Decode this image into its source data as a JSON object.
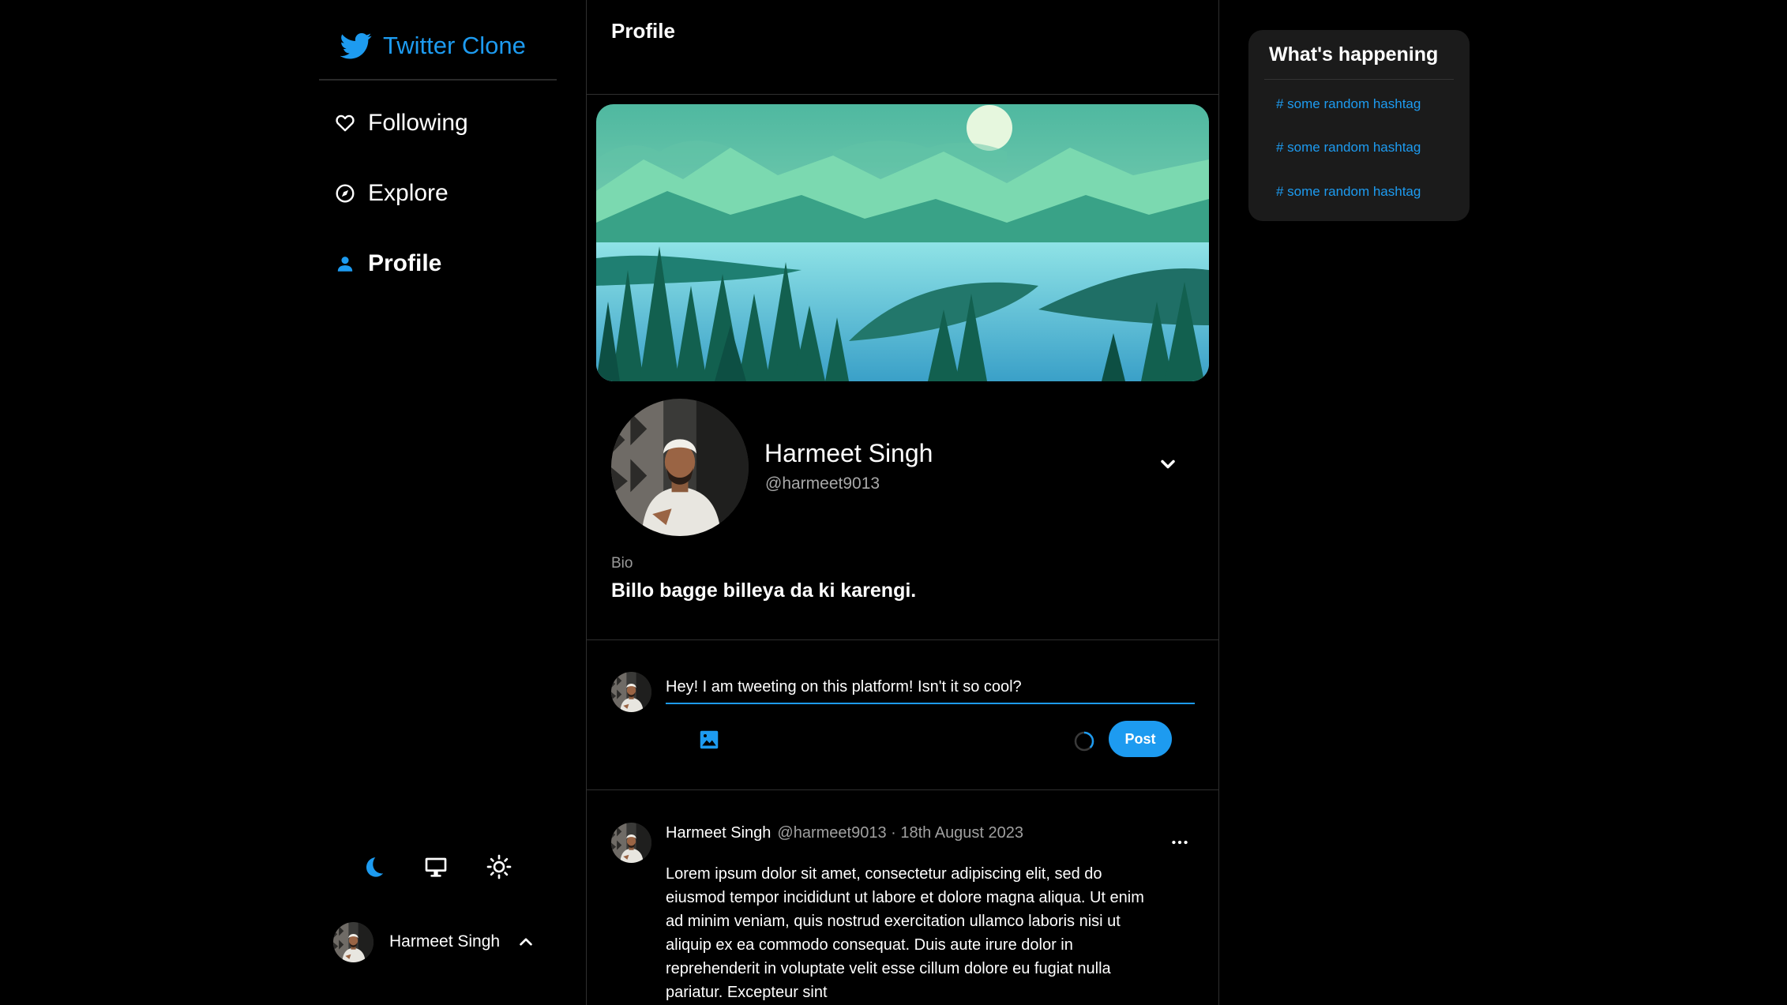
{
  "brand": {
    "name": "Twitter Clone",
    "icon": "twitter-bird-icon",
    "color": "#1d9bf0"
  },
  "nav": [
    {
      "label": "Following",
      "icon": "heart-icon",
      "active": false
    },
    {
      "label": "Explore",
      "icon": "compass-icon",
      "active": false
    },
    {
      "label": "Profile",
      "icon": "person-icon",
      "active": true
    }
  ],
  "theme_switcher": [
    {
      "icon": "moon-icon",
      "selected": true
    },
    {
      "icon": "monitor-icon",
      "selected": false
    },
    {
      "icon": "sun-icon",
      "selected": false
    }
  ],
  "account": {
    "name": "Harmeet Singh",
    "icon": "chevron-up-icon"
  },
  "header": {
    "title": "Profile"
  },
  "profile": {
    "name": "Harmeet Singh",
    "handle": "@harmeet9013",
    "bio_label": "Bio",
    "bio": "Billo bagge billeya da ki karengi."
  },
  "composer": {
    "value": "Hey! I am tweeting on this platform! Isn't it so cool?",
    "post_label": "Post"
  },
  "tweet": {
    "author": "Harmeet Singh",
    "meta": "@harmeet9013 · 18th August 2023",
    "body": "Lorem ipsum dolor sit amet, consectetur adipiscing elit, sed do eiusmod tempor incididunt ut labore et dolore magna aliqua. Ut enim ad minim veniam, quis nostrud exercitation ullamco laboris nisi ut aliquip ex ea commodo consequat. Duis aute irure dolor in reprehenderit in voluptate velit esse cillum dolore eu fugiat nulla pariatur. Excepteur sint"
  },
  "trends": {
    "title": "What's happening",
    "items": [
      "# some random hashtag",
      "# some random hashtag",
      "# some random hashtag"
    ]
  },
  "colors": {
    "accent": "#1d9bf0",
    "background": "#000000",
    "panel": "#1b1b1b"
  }
}
